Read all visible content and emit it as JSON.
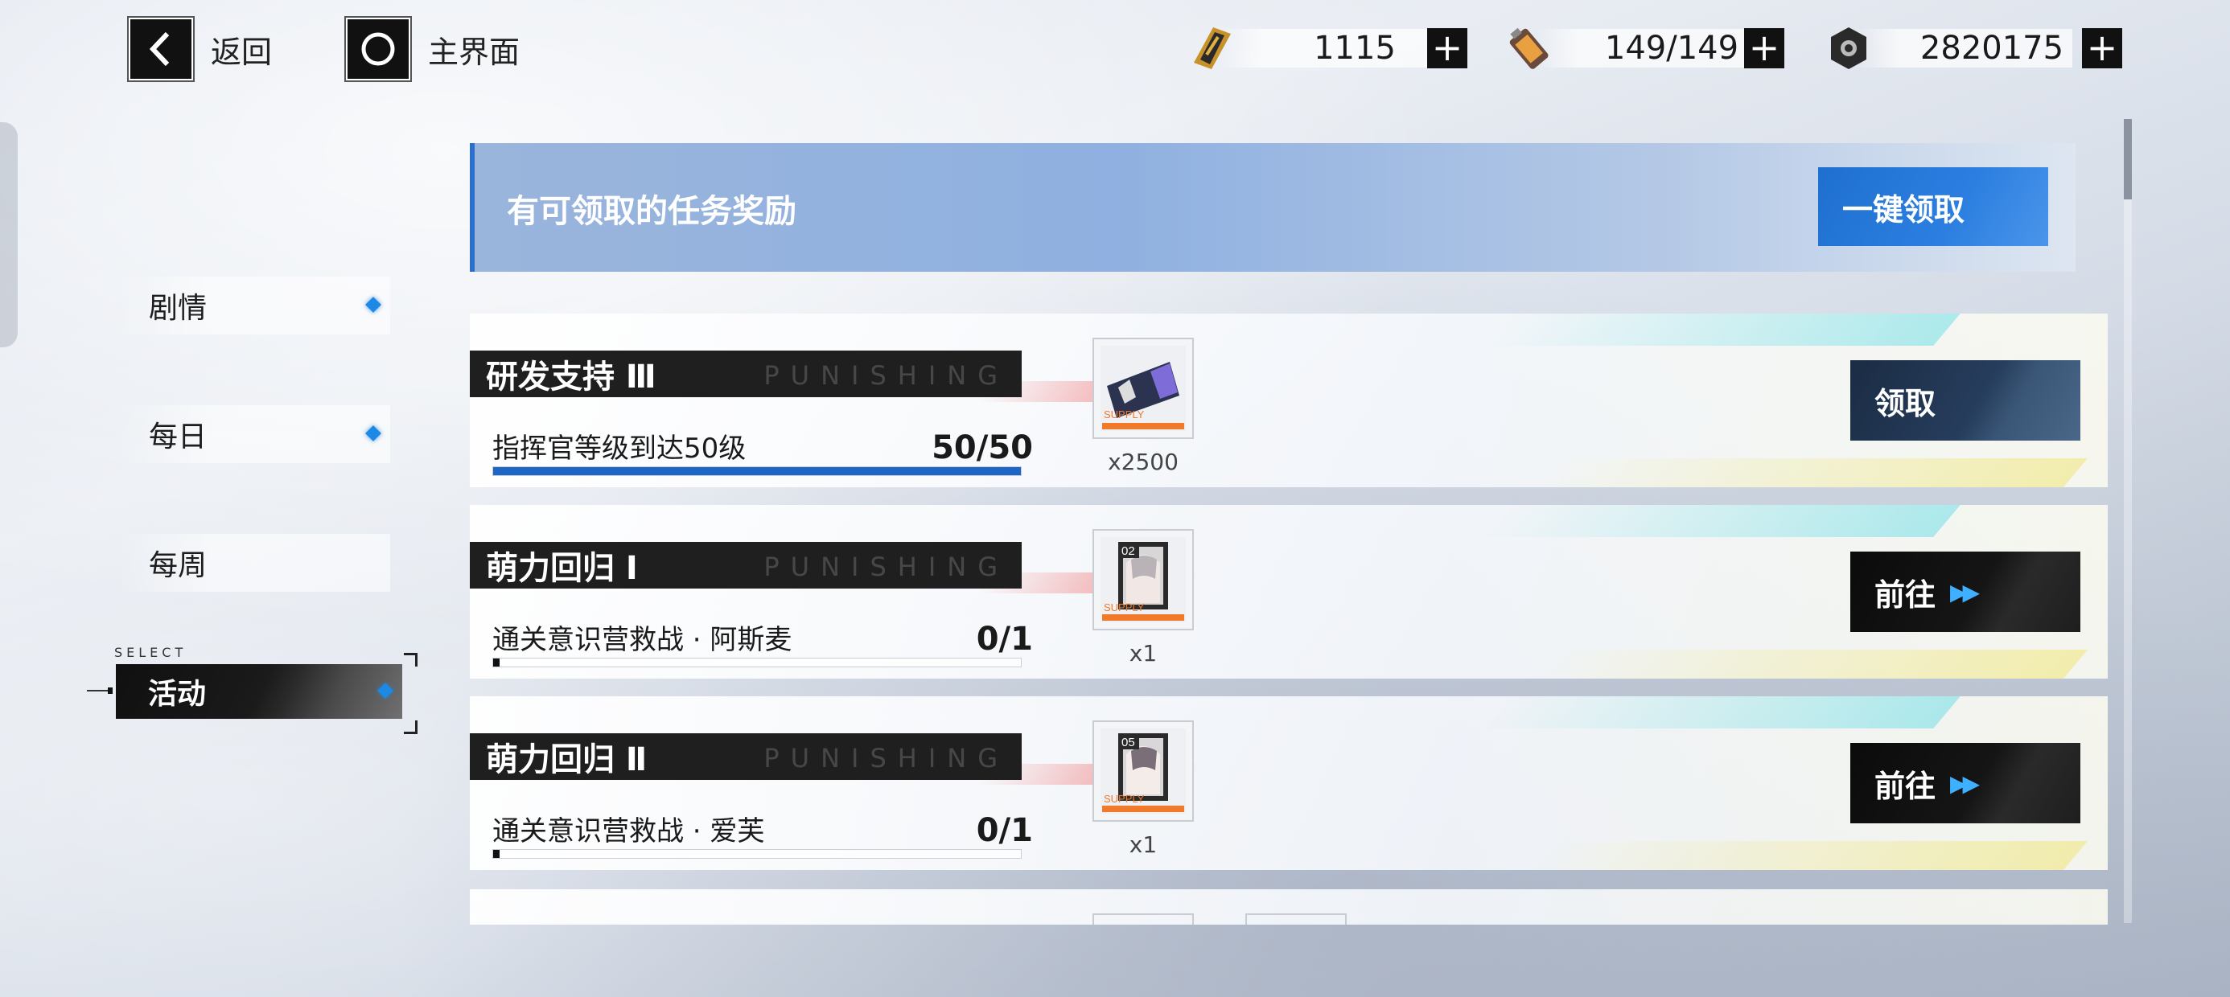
{
  "topbar": {
    "back_label": "返回",
    "home_label": "主界面",
    "resources": [
      {
        "icon": "ticket-icon",
        "value": "1115"
      },
      {
        "icon": "battery-icon",
        "value": "149/149"
      },
      {
        "icon": "coin-icon",
        "value": "2820175"
      }
    ],
    "plus_label": "+"
  },
  "sidebar": {
    "items": [
      {
        "label": "剧情",
        "has_dot": true
      },
      {
        "label": "每日",
        "has_dot": true
      },
      {
        "label": "每周",
        "has_dot": false
      },
      {
        "label": "活动",
        "has_dot": true,
        "active": true
      }
    ],
    "select_tag": "SELECT"
  },
  "banner": {
    "title": "有可领取的任务奖励",
    "claim_all_label": "一键领取"
  },
  "tasks": [
    {
      "title": "研发支持 Ⅲ",
      "watermark": "PUNISHING",
      "description": "指挥官等级到达50级",
      "progress_text": "50/50",
      "progress_fraction": 1.0,
      "reward_icon": "supply-ticket-icon",
      "reward_count": "x2500",
      "action_label": "领取",
      "action_type": "claim"
    },
    {
      "title": "萌力回归 Ⅰ",
      "watermark": "PUNISHING",
      "description": "通关意识营救战 · 阿斯麦",
      "progress_text": "0/1",
      "progress_fraction": 0.0,
      "reward_icon": "memory-card-icon",
      "reward_badge": "02",
      "reward_count": "x1",
      "action_label": "前往",
      "action_type": "go"
    },
    {
      "title": "萌力回归 Ⅱ",
      "watermark": "PUNISHING",
      "description": "通关意识营救战 · 爱芙",
      "progress_text": "0/1",
      "progress_fraction": 0.0,
      "reward_icon": "memory-card-icon",
      "reward_badge": "05",
      "reward_count": "x1",
      "action_label": "前往",
      "action_type": "go"
    }
  ],
  "supply_text": "SUPPLY",
  "colors": {
    "accent_blue": "#1e66c5",
    "dot_blue": "#1e88e5",
    "arrow_cyan": "#3fb0ff",
    "supply_orange": "#f07a2a"
  }
}
